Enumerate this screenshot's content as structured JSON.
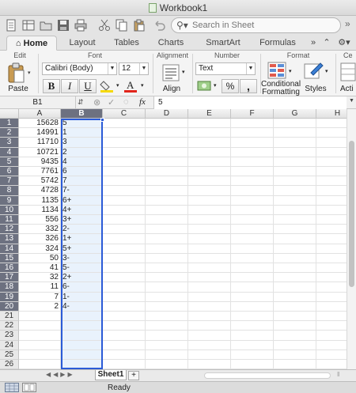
{
  "window": {
    "title": "Workbook1"
  },
  "search": {
    "placeholder": "Search in Sheet"
  },
  "tabs": [
    "Home",
    "Layout",
    "Tables",
    "Charts",
    "SmartArt",
    "Formulas"
  ],
  "ribbon": {
    "groups": {
      "edit": "Edit",
      "font": "Font",
      "alignment": "Alignment",
      "number": "Number",
      "format": "Format",
      "cells": "Ce"
    },
    "paste_label": "Paste",
    "font_name": "Calibri (Body)",
    "font_size": "12",
    "bold": "B",
    "italic": "I",
    "underline": "U",
    "align_label": "Align",
    "number_format": "Text",
    "percent": "%",
    "comma": ",",
    "conditional_formatting_1": "Conditional",
    "conditional_formatting_2": "Formatting",
    "styles_label": "Styles",
    "actions_label": "Acti"
  },
  "formula_bar": {
    "cell_ref": "B1",
    "fx": "fx",
    "value": "5"
  },
  "columns": [
    "A",
    "B",
    "C",
    "D",
    "E",
    "F",
    "G",
    "H"
  ],
  "selected_column": "B",
  "rows": [
    [
      "15628",
      "5"
    ],
    [
      "14991",
      "1"
    ],
    [
      "11710",
      "3"
    ],
    [
      "10721",
      "2"
    ],
    [
      "9435",
      "4"
    ],
    [
      "7761",
      "6"
    ],
    [
      "5742",
      "7"
    ],
    [
      "4728",
      "7-"
    ],
    [
      "1135",
      "6+"
    ],
    [
      "1134",
      "4+"
    ],
    [
      "556",
      "3+"
    ],
    [
      "332",
      "2-"
    ],
    [
      "326",
      "1+"
    ],
    [
      "324",
      "5+"
    ],
    [
      "50",
      "3-"
    ],
    [
      "41",
      "5-"
    ],
    [
      "32",
      "2+"
    ],
    [
      "11",
      "6-"
    ],
    [
      "7",
      "1-"
    ],
    [
      "2",
      "4-"
    ],
    [
      "",
      ""
    ],
    [
      "",
      ""
    ],
    [
      "",
      ""
    ],
    [
      "",
      ""
    ],
    [
      "",
      ""
    ],
    [
      "",
      ""
    ]
  ],
  "sheet_tabs": [
    "Sheet1"
  ],
  "add_sheet": "+",
  "status": {
    "text": "Ready"
  },
  "colors": {
    "accent_green": "#217346",
    "selection": "#2b5bd7",
    "selection_fill": "#e9f2fc"
  }
}
